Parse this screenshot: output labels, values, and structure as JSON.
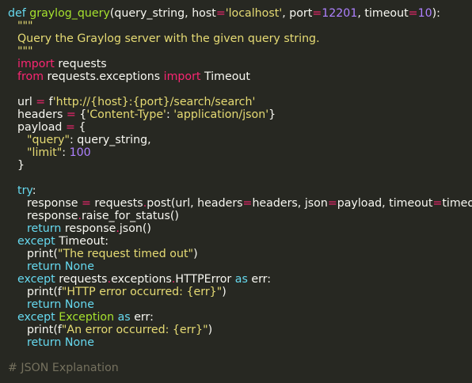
{
  "colors": {
    "background": "#272822",
    "default": "#f8f8f2",
    "keyword": "#66d9ef",
    "function_name": "#a6e22e",
    "string": "#e6db74",
    "number": "#ae81ff",
    "operator": "#f92672",
    "comment": "#75715e"
  },
  "code": {
    "lines": [
      {
        "indent": 0,
        "tokens": [
          {
            "t": "def",
            "c": "keyword"
          },
          {
            "t": " ",
            "c": "default"
          },
          {
            "t": "graylog_query",
            "c": "function_name"
          },
          {
            "t": "(query_string, host",
            "c": "default"
          },
          {
            "t": "=",
            "c": "operator"
          },
          {
            "t": "'localhost'",
            "c": "string"
          },
          {
            "t": ", port",
            "c": "default"
          },
          {
            "t": "=",
            "c": "operator"
          },
          {
            "t": "12201",
            "c": "number"
          },
          {
            "t": ", timeout",
            "c": "default"
          },
          {
            "t": "=",
            "c": "operator"
          },
          {
            "t": "10",
            "c": "number"
          },
          {
            "t": "):",
            "c": "default"
          }
        ]
      },
      {
        "indent": 1,
        "tokens": [
          {
            "t": "\"\"\"",
            "c": "string"
          }
        ]
      },
      {
        "indent": 1,
        "tokens": [
          {
            "t": "Query the Graylog server with the given query string.",
            "c": "string"
          }
        ]
      },
      {
        "indent": 1,
        "tokens": [
          {
            "t": "\"\"\"",
            "c": "string"
          }
        ]
      },
      {
        "indent": 1,
        "tokens": [
          {
            "t": "import",
            "c": "operator"
          },
          {
            "t": " requests",
            "c": "default"
          }
        ]
      },
      {
        "indent": 1,
        "tokens": [
          {
            "t": "from",
            "c": "operator"
          },
          {
            "t": " requests.exceptions ",
            "c": "default"
          },
          {
            "t": "import",
            "c": "operator"
          },
          {
            "t": " Timeout",
            "c": "default"
          }
        ]
      },
      {
        "blank": true
      },
      {
        "indent": 1,
        "tokens": [
          {
            "t": "url ",
            "c": "default"
          },
          {
            "t": "=",
            "c": "operator"
          },
          {
            "t": " f",
            "c": "default"
          },
          {
            "t": "'http://{host}:{port}/search/search'",
            "c": "string"
          }
        ]
      },
      {
        "indent": 1,
        "tokens": [
          {
            "t": "headers ",
            "c": "default"
          },
          {
            "t": "=",
            "c": "operator"
          },
          {
            "t": " {",
            "c": "default"
          },
          {
            "t": "'Content-Type'",
            "c": "string"
          },
          {
            "t": ": ",
            "c": "default"
          },
          {
            "t": "'application/json'",
            "c": "string"
          },
          {
            "t": "}",
            "c": "default"
          }
        ]
      },
      {
        "indent": 1,
        "tokens": [
          {
            "t": "payload ",
            "c": "default"
          },
          {
            "t": "=",
            "c": "operator"
          },
          {
            "t": " {",
            "c": "default"
          }
        ]
      },
      {
        "indent": 2,
        "tokens": [
          {
            "t": "\"query\"",
            "c": "string"
          },
          {
            "t": ": query_string,",
            "c": "default"
          }
        ]
      },
      {
        "indent": 2,
        "tokens": [
          {
            "t": "\"limit\"",
            "c": "string"
          },
          {
            "t": ": ",
            "c": "default"
          },
          {
            "t": "100",
            "c": "number"
          }
        ]
      },
      {
        "indent": 1,
        "tokens": [
          {
            "t": "}",
            "c": "default"
          }
        ]
      },
      {
        "blank": true
      },
      {
        "indent": 1,
        "tokens": [
          {
            "t": "try",
            "c": "keyword"
          },
          {
            "t": ":",
            "c": "default"
          }
        ]
      },
      {
        "indent": 2,
        "tokens": [
          {
            "t": "response ",
            "c": "default"
          },
          {
            "t": "=",
            "c": "operator"
          },
          {
            "t": " requests",
            "c": "default"
          },
          {
            "t": ".",
            "c": "operator"
          },
          {
            "t": "post(url, headers",
            "c": "default"
          },
          {
            "t": "=",
            "c": "operator"
          },
          {
            "t": "headers, json",
            "c": "default"
          },
          {
            "t": "=",
            "c": "operator"
          },
          {
            "t": "payload, timeout",
            "c": "default"
          },
          {
            "t": "=",
            "c": "operator"
          },
          {
            "t": "timeout)",
            "c": "default"
          }
        ]
      },
      {
        "indent": 2,
        "tokens": [
          {
            "t": "response",
            "c": "default"
          },
          {
            "t": ".",
            "c": "operator"
          },
          {
            "t": "raise_for_status()",
            "c": "default"
          }
        ]
      },
      {
        "indent": 2,
        "tokens": [
          {
            "t": "return",
            "c": "keyword"
          },
          {
            "t": " response",
            "c": "default"
          },
          {
            "t": ".",
            "c": "operator"
          },
          {
            "t": "json()",
            "c": "default"
          }
        ]
      },
      {
        "indent": 1,
        "tokens": [
          {
            "t": "except",
            "c": "keyword"
          },
          {
            "t": " Timeout:",
            "c": "default"
          }
        ]
      },
      {
        "indent": 2,
        "tokens": [
          {
            "t": "print(",
            "c": "default"
          },
          {
            "t": "\"The request timed out\"",
            "c": "string"
          },
          {
            "t": ")",
            "c": "default"
          }
        ]
      },
      {
        "indent": 2,
        "tokens": [
          {
            "t": "return",
            "c": "keyword"
          },
          {
            "t": " ",
            "c": "default"
          },
          {
            "t": "None",
            "c": "keyword"
          }
        ]
      },
      {
        "indent": 1,
        "tokens": [
          {
            "t": "except",
            "c": "keyword"
          },
          {
            "t": " requests",
            "c": "default"
          },
          {
            "t": ".",
            "c": "operator"
          },
          {
            "t": "exceptions",
            "c": "default"
          },
          {
            "t": ".",
            "c": "operator"
          },
          {
            "t": "HTTPError ",
            "c": "default"
          },
          {
            "t": "as",
            "c": "keyword"
          },
          {
            "t": " err:",
            "c": "default"
          }
        ]
      },
      {
        "indent": 2,
        "tokens": [
          {
            "t": "print(f",
            "c": "default"
          },
          {
            "t": "\"HTTP error occurred: {err}\"",
            "c": "string"
          },
          {
            "t": ")",
            "c": "default"
          }
        ]
      },
      {
        "indent": 2,
        "tokens": [
          {
            "t": "return",
            "c": "keyword"
          },
          {
            "t": " ",
            "c": "default"
          },
          {
            "t": "None",
            "c": "keyword"
          }
        ]
      },
      {
        "indent": 1,
        "tokens": [
          {
            "t": "except",
            "c": "keyword"
          },
          {
            "t": " ",
            "c": "default"
          },
          {
            "t": "Exception",
            "c": "function_name"
          },
          {
            "t": " ",
            "c": "default"
          },
          {
            "t": "as",
            "c": "keyword"
          },
          {
            "t": " err:",
            "c": "default"
          }
        ]
      },
      {
        "indent": 2,
        "tokens": [
          {
            "t": "print(f",
            "c": "default"
          },
          {
            "t": "\"An error occurred: {err}\"",
            "c": "string"
          },
          {
            "t": ")",
            "c": "default"
          }
        ]
      },
      {
        "indent": 2,
        "tokens": [
          {
            "t": "return",
            "c": "keyword"
          },
          {
            "t": " ",
            "c": "default"
          },
          {
            "t": "None",
            "c": "keyword"
          }
        ]
      },
      {
        "blank": true
      },
      {
        "indent": 0,
        "tokens": [
          {
            "t": "# JSON Explanation",
            "c": "comment"
          }
        ]
      }
    ]
  }
}
